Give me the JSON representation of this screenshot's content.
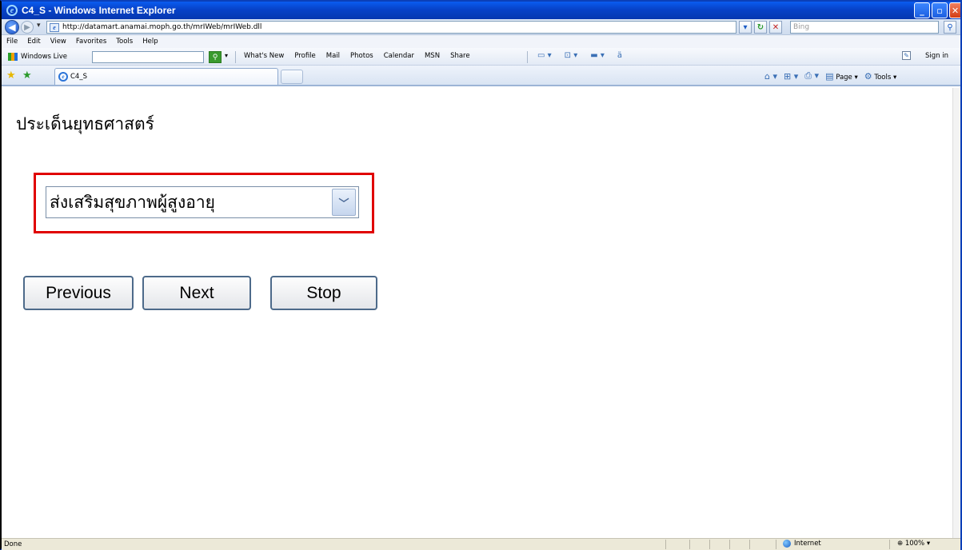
{
  "window": {
    "title": "C4_S - Windows Internet Explorer"
  },
  "address_bar": {
    "url": "http://datamart.anamai.moph.go.th/mrIWeb/mrIWeb.dll",
    "search_placeholder": "Bing"
  },
  "menu": [
    "File",
    "Edit",
    "View",
    "Favorites",
    "Tools",
    "Help"
  ],
  "live_toolbar": {
    "brand": "Windows Live",
    "links": [
      "What's New",
      "Profile",
      "Mail",
      "Photos",
      "Calendar",
      "MSN",
      "Share"
    ],
    "sign_in": "Sign in"
  },
  "tab": {
    "title": "C4_S"
  },
  "command_bar": {
    "page": "Page",
    "tools": "Tools"
  },
  "page": {
    "heading": "ประเด็นยุทธศาสตร์",
    "select_value": "ส่งเสริมสุขภาพผู้สูงอายุ",
    "buttons": {
      "previous": "Previous",
      "next": "Next",
      "stop": "Stop"
    }
  },
  "status": {
    "text": "Done",
    "zone": "Internet",
    "zoom": "100%"
  },
  "colors": {
    "highlight": "#e00000",
    "titlebar": "#0742c8"
  }
}
